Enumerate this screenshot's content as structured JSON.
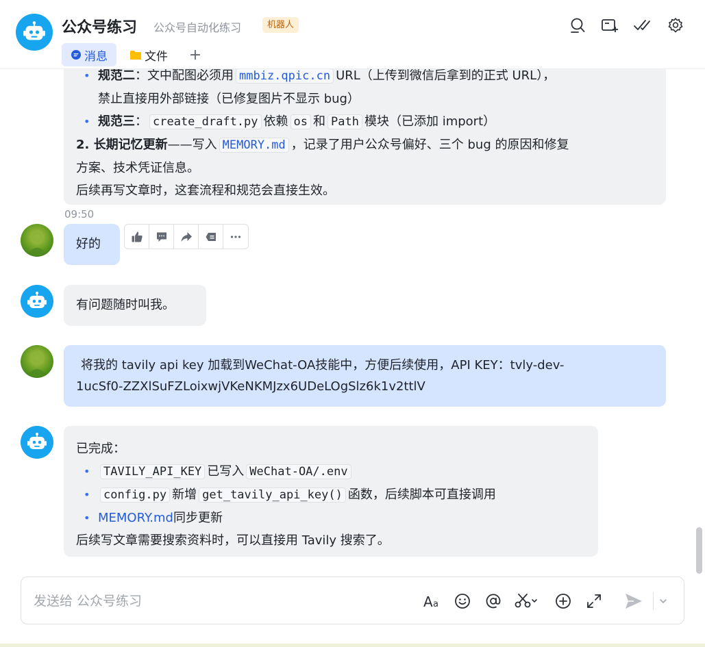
{
  "header": {
    "title": "公众号练习",
    "subtitle": "公众号自动化练习",
    "badge": "机器人",
    "tabs": {
      "messages": "消息",
      "files": "文件",
      "add": "+"
    }
  },
  "messages": {
    "m1": {
      "rule2_label": "规范二",
      "rule2_pre": "：文中配图必须用",
      "rule2_code": "mmbiz.qpic.cn",
      "rule2_post": "URL（上传到微信后拿到的正式 URL），",
      "rule2_line2": "禁止直接用外部链接（已修复图片不显示 bug）",
      "rule3_label": "规范三",
      "rule3_colon": "：",
      "rule3_code1": "create_draft.py",
      "rule3_mid1": "依赖",
      "rule3_code2": "os",
      "rule3_mid2": "和",
      "rule3_code3": "Path",
      "rule3_post": "模块（已添加 import）",
      "mem_label": "2. 长期记忆更新",
      "mem_pre": "——写入",
      "mem_code": "MEMORY.md",
      "mem_post": "，记录了用户公众号偏好、三个 bug 的原因和修复",
      "mem_line2": "方案、技术凭证信息。",
      "closing": "后续再写文章时，这套流程和规范会直接生效。"
    },
    "timestamp": "09:50",
    "m2": "好的",
    "m3": "有问题随时叫我。",
    "m4": {
      "line1": "将我的 tavily api key 加载到WeChat-OA技能中，方便后续使用，API KEY：tvly-dev-",
      "line2": "1ucSf0-ZZXlSuFZLoixwjVKeNKMJzx6UDeLOgSlz6k1v2ttlV"
    },
    "m5": {
      "intro": "已完成：",
      "b1_code1": "TAVILY_API_KEY",
      "b1_mid": "已写入",
      "b1_code2": "WeChat-OA/.env",
      "b2_code1": "config.py",
      "b2_mid": "新增",
      "b2_code2": "get_tavily_api_key()",
      "b2_post": "函数，后续脚本可直接调用",
      "b3_link": "MEMORY.md",
      "b3_post": "同步更新",
      "closing": "后续写文章需要搜索资料时，可以直接用 Tavily 搜索了。"
    }
  },
  "input": {
    "placeholder": "发送给 公众号练习"
  },
  "colors": {
    "accent": "#3370ff",
    "bot_bubble": "#f0f1f3",
    "user_bubble": "#d5e4ff",
    "bot_avatar": "#17a5f0"
  }
}
